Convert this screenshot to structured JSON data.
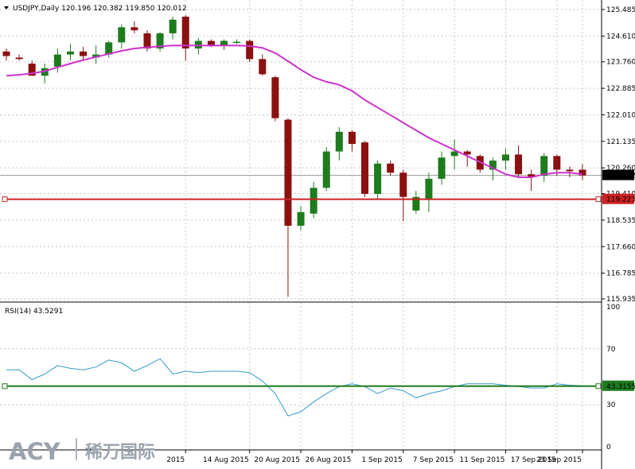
{
  "chart_data": [
    {
      "type": "candlestick",
      "title": "USDJPY,Daily  120.196 120.382 119.850 120.012",
      "price_ticks": [
        "125.485",
        "124.610",
        "123.760",
        "122.885",
        "122.010",
        "121.135",
        "120.260",
        "119.410",
        "118.535",
        "117.660",
        "116.785",
        "115.935"
      ],
      "x_labels": [
        "2015",
        "14 Aug 2015",
        "20 Aug 2015",
        "26 Aug 2015",
        "1 Sep 2015",
        "7 Sep 2015",
        "11 Sep 2015",
        "17 Sep 2015",
        "23 Sep 2015"
      ],
      "current_price": "120.012",
      "support_level": "119.223",
      "support_value": 119.223,
      "ma_color": "#cc33cc",
      "bull_color": "#1e7b1e",
      "bear_color": "#8b1010",
      "support_color": "#cc2222",
      "candles": [
        {
          "o": 124.1,
          "h": 124.2,
          "l": 123.8,
          "c": 123.95
        },
        {
          "o": 123.9,
          "h": 124.0,
          "l": 123.8,
          "c": 123.85
        },
        {
          "o": 123.7,
          "h": 123.8,
          "l": 123.3,
          "c": 123.3
        },
        {
          "o": 123.3,
          "h": 123.7,
          "l": 123.05,
          "c": 123.55
        },
        {
          "o": 123.6,
          "h": 124.2,
          "l": 123.4,
          "c": 124.0
        },
        {
          "o": 124.0,
          "h": 124.35,
          "l": 123.8,
          "c": 124.1
        },
        {
          "o": 124.1,
          "h": 124.25,
          "l": 123.8,
          "c": 123.95
        },
        {
          "o": 123.9,
          "h": 124.3,
          "l": 123.7,
          "c": 124.0
        },
        {
          "o": 124.0,
          "h": 124.45,
          "l": 123.9,
          "c": 124.4
        },
        {
          "o": 124.4,
          "h": 125.0,
          "l": 124.2,
          "c": 124.9
        },
        {
          "o": 124.9,
          "h": 125.1,
          "l": 124.7,
          "c": 124.8
        },
        {
          "o": 124.7,
          "h": 124.8,
          "l": 124.1,
          "c": 124.2
        },
        {
          "o": 124.2,
          "h": 124.75,
          "l": 124.1,
          "c": 124.7
        },
        {
          "o": 124.7,
          "h": 125.25,
          "l": 124.5,
          "c": 125.15
        },
        {
          "o": 125.25,
          "h": 125.3,
          "l": 123.8,
          "c": 124.2
        },
        {
          "o": 124.2,
          "h": 124.55,
          "l": 124.0,
          "c": 124.45
        },
        {
          "o": 124.45,
          "h": 124.5,
          "l": 124.25,
          "c": 124.3
        },
        {
          "o": 124.3,
          "h": 124.5,
          "l": 124.15,
          "c": 124.45
        },
        {
          "o": 124.4,
          "h": 124.5,
          "l": 124.35,
          "c": 124.42
        },
        {
          "o": 124.45,
          "h": 124.5,
          "l": 123.75,
          "c": 123.85
        },
        {
          "o": 123.85,
          "h": 124.0,
          "l": 123.3,
          "c": 123.35
        },
        {
          "o": 123.25,
          "h": 123.3,
          "l": 121.8,
          "c": 121.9
        },
        {
          "o": 121.85,
          "h": 121.9,
          "l": 116.0,
          "c": 118.35
        },
        {
          "o": 118.35,
          "h": 119.0,
          "l": 118.2,
          "c": 118.8
        },
        {
          "o": 118.75,
          "h": 119.8,
          "l": 118.6,
          "c": 119.6
        },
        {
          "o": 119.6,
          "h": 120.95,
          "l": 119.5,
          "c": 120.8
        },
        {
          "o": 120.8,
          "h": 121.6,
          "l": 120.5,
          "c": 121.45
        },
        {
          "o": 121.45,
          "h": 121.5,
          "l": 120.8,
          "c": 121.05
        },
        {
          "o": 121.1,
          "h": 121.15,
          "l": 119.3,
          "c": 119.4
        },
        {
          "o": 119.4,
          "h": 120.5,
          "l": 119.2,
          "c": 120.4
        },
        {
          "o": 120.4,
          "h": 120.5,
          "l": 120.0,
          "c": 120.1
        },
        {
          "o": 120.1,
          "h": 120.2,
          "l": 118.5,
          "c": 119.3
        },
        {
          "o": 118.85,
          "h": 119.5,
          "l": 118.75,
          "c": 119.3
        },
        {
          "o": 119.25,
          "h": 120.1,
          "l": 118.8,
          "c": 119.9
        },
        {
          "o": 119.9,
          "h": 120.8,
          "l": 119.7,
          "c": 120.6
        },
        {
          "o": 120.65,
          "h": 121.2,
          "l": 120.2,
          "c": 120.8
        },
        {
          "o": 120.8,
          "h": 120.85,
          "l": 120.3,
          "c": 120.7
        },
        {
          "o": 120.65,
          "h": 120.7,
          "l": 120.1,
          "c": 120.2
        },
        {
          "o": 120.2,
          "h": 120.6,
          "l": 119.85,
          "c": 120.5
        },
        {
          "o": 120.5,
          "h": 120.9,
          "l": 120.2,
          "c": 120.7
        },
        {
          "o": 120.7,
          "h": 121.0,
          "l": 119.95,
          "c": 120.05
        },
        {
          "o": 120.05,
          "h": 120.2,
          "l": 119.5,
          "c": 119.95
        },
        {
          "o": 120.0,
          "h": 120.75,
          "l": 119.8,
          "c": 120.65
        },
        {
          "o": 120.65,
          "h": 120.7,
          "l": 120.0,
          "c": 120.2
        },
        {
          "o": 120.2,
          "h": 120.3,
          "l": 119.95,
          "c": 120.15
        },
        {
          "o": 120.2,
          "h": 120.38,
          "l": 119.85,
          "c": 120.01
        }
      ],
      "ma": [
        123.3,
        123.33,
        123.38,
        123.45,
        123.58,
        123.7,
        123.82,
        123.92,
        124.02,
        124.12,
        124.2,
        124.24,
        124.27,
        124.3,
        124.3,
        124.3,
        124.3,
        124.3,
        124.3,
        124.28,
        124.22,
        124.05,
        123.78,
        123.5,
        123.25,
        123.1,
        123.0,
        122.8,
        122.5,
        122.25,
        122.0,
        121.75,
        121.5,
        121.25,
        121.05,
        120.85,
        120.65,
        120.45,
        120.25,
        120.05,
        119.95,
        119.95,
        120.05,
        120.1,
        120.1,
        120.05
      ]
    },
    {
      "type": "line",
      "title": "RSI(14) 43.5291",
      "y_ticks": [
        "100",
        "70",
        "30",
        "0"
      ],
      "current_value": "43.3155",
      "level": 43.3155,
      "color": "#3399cc",
      "level_color": "#1e7b1e",
      "values": [
        55,
        55,
        48,
        52,
        58,
        56,
        55,
        57,
        62,
        60,
        54,
        58,
        63,
        52,
        54,
        53,
        54,
        54,
        54,
        53,
        47,
        38,
        22,
        25,
        32,
        38,
        43,
        45,
        43,
        38,
        42,
        40,
        35,
        38,
        40,
        43,
        45,
        45,
        45,
        44,
        43,
        42,
        42,
        45,
        44,
        43.5
      ]
    }
  ],
  "watermark": {
    "brand": "ACY",
    "cn": "稀万国际"
  }
}
